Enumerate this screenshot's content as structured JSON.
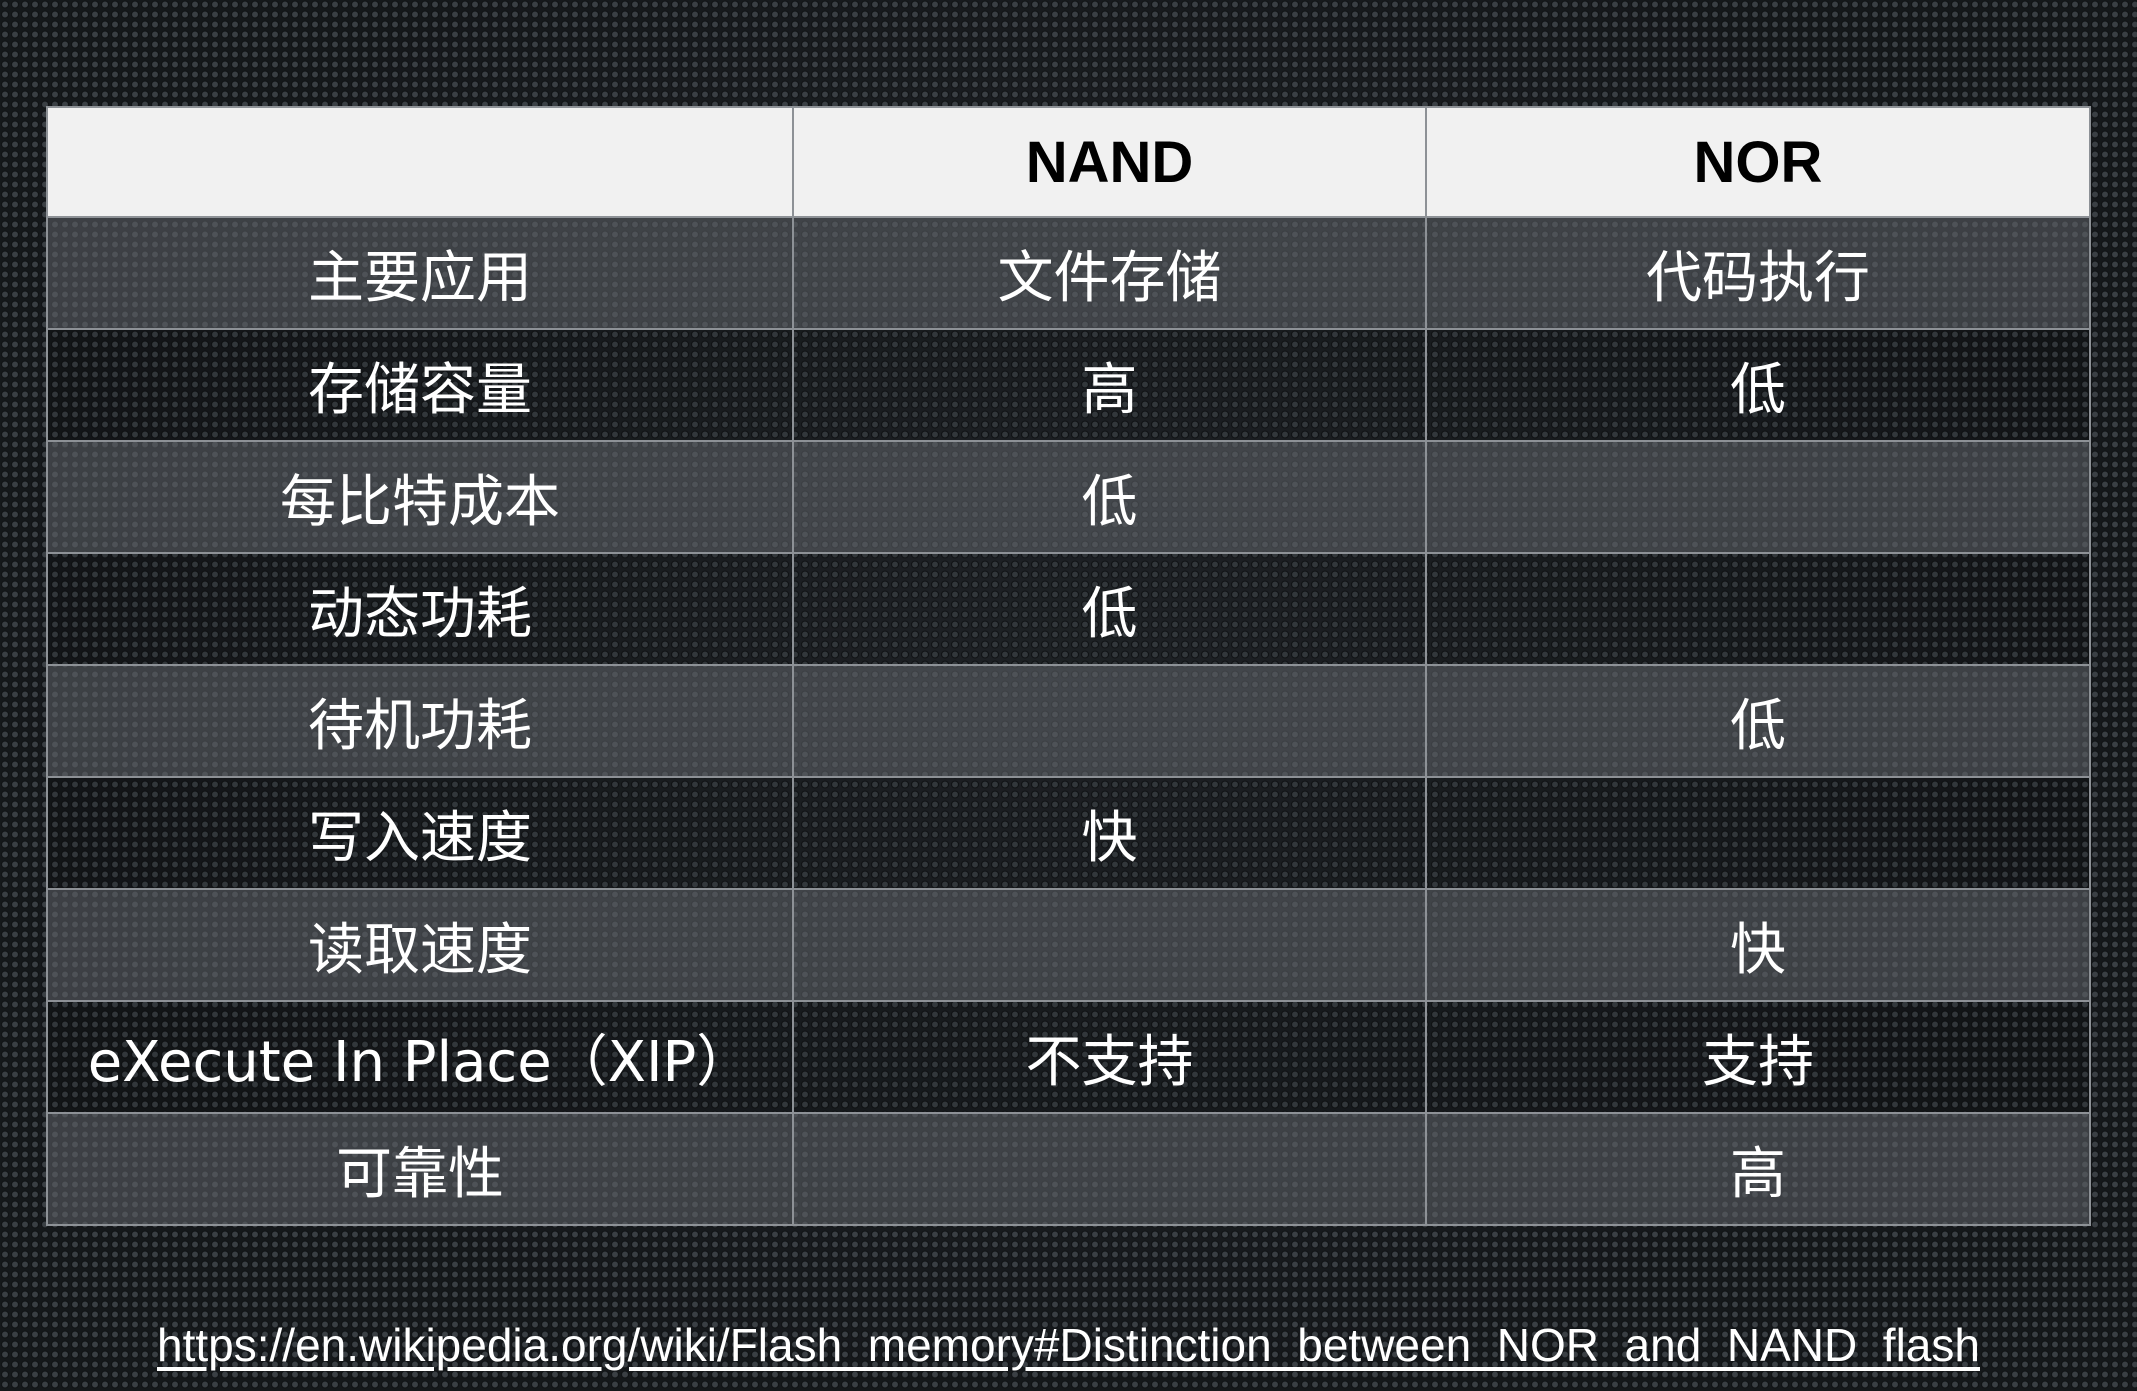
{
  "table": {
    "headers": [
      "",
      "NAND",
      "NOR"
    ],
    "rows": [
      {
        "feature": "主要应用",
        "nand": "文件存储",
        "nor": "代码执行"
      },
      {
        "feature": "存储容量",
        "nand": "高",
        "nor": "低"
      },
      {
        "feature": "每比特成本",
        "nand": "低",
        "nor": ""
      },
      {
        "feature": "动态功耗",
        "nand": "低",
        "nor": ""
      },
      {
        "feature": "待机功耗",
        "nand": "",
        "nor": "低"
      },
      {
        "feature": "写入速度",
        "nand": "快",
        "nor": ""
      },
      {
        "feature": "读取速度",
        "nand": "",
        "nor": "快"
      },
      {
        "feature": "eXecute In Place（XIP）",
        "nand": "不支持",
        "nor": "支持"
      },
      {
        "feature": "可靠性",
        "nand": "",
        "nor": "高"
      }
    ]
  },
  "source": {
    "url_text": "https://en.wikipedia.org/wiki/Flash_memory#Distinction_between_NOR_and_NAND_flash"
  },
  "colors": {
    "header_bg": "#f1f1f1",
    "grid_line": "#8d9196",
    "text": "#ffffff"
  }
}
